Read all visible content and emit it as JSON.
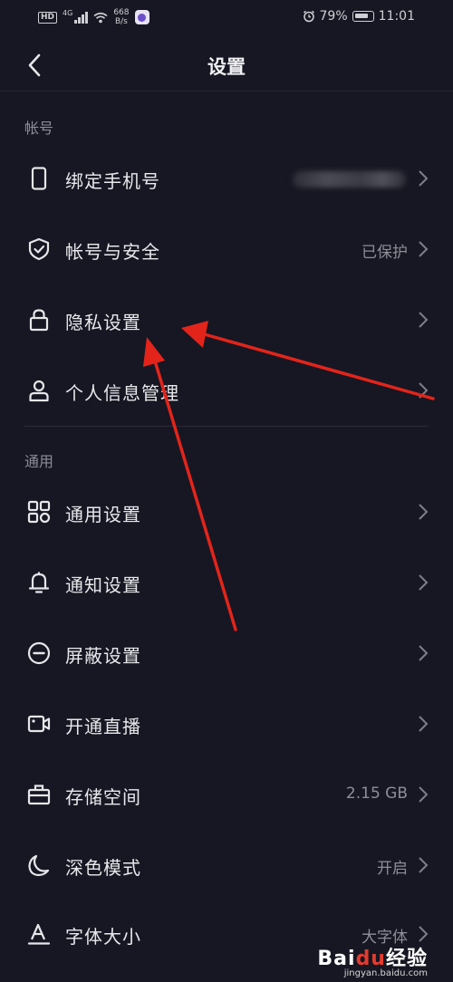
{
  "status_bar": {
    "hd": "HD",
    "network": "4G",
    "speed_value": "668",
    "speed_unit": "B/s",
    "battery": "79%",
    "time": "11:01"
  },
  "header": {
    "title": "设置"
  },
  "sections": [
    {
      "title": "帐号",
      "items": [
        {
          "label": "绑定手机号",
          "value": "",
          "icon": "phone-icon",
          "value_blurred": true
        },
        {
          "label": "帐号与安全",
          "value": "已保护",
          "icon": "shield-check-icon"
        },
        {
          "label": "隐私设置",
          "value": "",
          "icon": "lock-icon"
        },
        {
          "label": "个人信息管理",
          "value": "",
          "icon": "person-icon"
        }
      ]
    },
    {
      "title": "通用",
      "items": [
        {
          "label": "通用设置",
          "value": "",
          "icon": "grid-icon"
        },
        {
          "label": "通知设置",
          "value": "",
          "icon": "bell-icon"
        },
        {
          "label": "屏蔽设置",
          "value": "",
          "icon": "block-icon"
        },
        {
          "label": "开通直播",
          "value": "",
          "icon": "video-camera-icon"
        },
        {
          "label": "存储空间",
          "value": "2.15 GB",
          "icon": "storage-box-icon"
        },
        {
          "label": "深色模式",
          "value": "开启",
          "icon": "moon-icon"
        },
        {
          "label": "字体大小",
          "value": "大字体",
          "icon": "font-size-icon"
        }
      ]
    }
  ],
  "watermark": {
    "brand_prefix": "Bai",
    "brand_middle": "du",
    "brand_suffix": "经验",
    "url": "jingyan.baidu.com"
  },
  "colors": {
    "background": "#161722",
    "annotation_arrow": "#e3241b"
  }
}
